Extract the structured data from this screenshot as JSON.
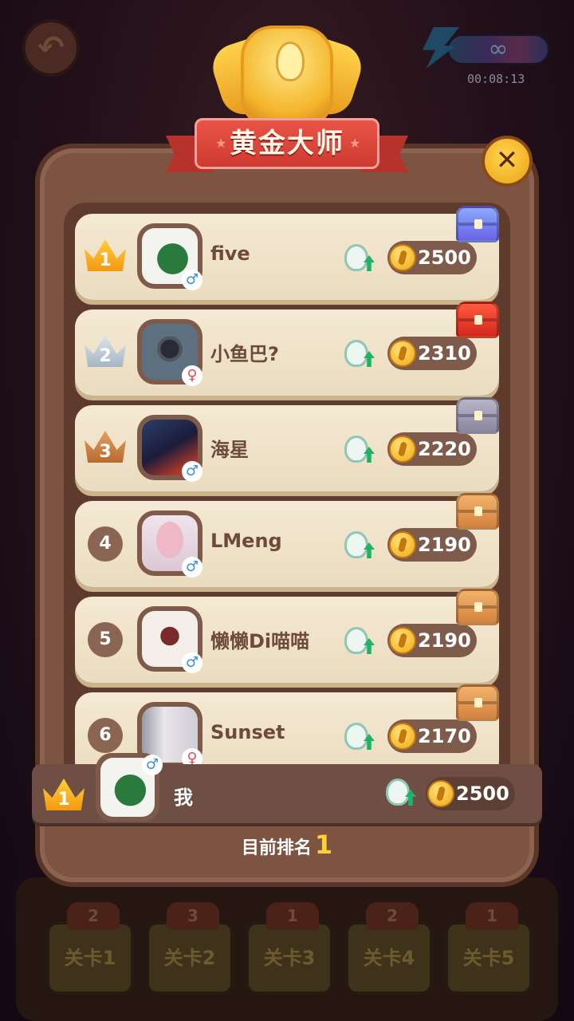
{
  "timer": "00:08:13",
  "infinity_symbol": "∞",
  "levels": [
    {
      "label": "关卡1",
      "count": "2"
    },
    {
      "label": "关卡2",
      "count": "3"
    },
    {
      "label": "关卡3",
      "count": "1"
    },
    {
      "label": "关卡4",
      "count": "2"
    },
    {
      "label": "关卡5",
      "count": "1"
    }
  ],
  "leaderboard": {
    "title": "黄金大师",
    "close_label": "✕",
    "players": [
      {
        "rank": "1",
        "name": "five",
        "score": "2500",
        "gender": "♂"
      },
      {
        "rank": "2",
        "name": "小鱼巴?",
        "score": "2310",
        "gender": "♀"
      },
      {
        "rank": "3",
        "name": "海星",
        "score": "2220",
        "gender": "♂"
      },
      {
        "rank": "4",
        "name": "LMeng",
        "score": "2190",
        "gender": "♂"
      },
      {
        "rank": "5",
        "name": "懒懒Di喵喵",
        "score": "2190",
        "gender": "♂"
      },
      {
        "rank": "6",
        "name": "Sunset",
        "score": "2170",
        "gender": "♀"
      }
    ],
    "me": {
      "rank": "1",
      "name": "我",
      "score": "2500",
      "gender": "♂"
    },
    "current_rank_label": "目前排名",
    "current_rank_value": "1"
  },
  "colors": {
    "panel": "#7d5441",
    "row": "#f4e9d3",
    "ribbon": "#cf3a30",
    "gold": "#ffd03a"
  }
}
